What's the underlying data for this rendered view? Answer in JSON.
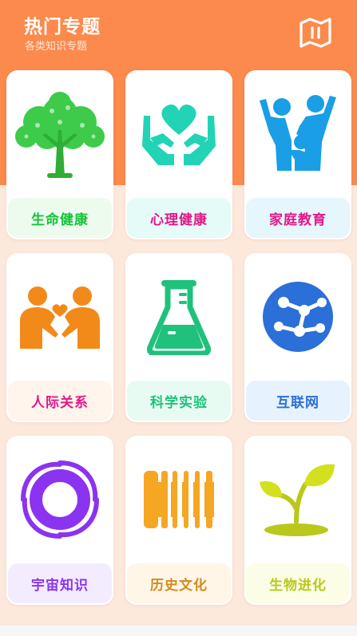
{
  "header": {
    "title": "热门专题",
    "subtitle": "各类知识专题",
    "map_icon": "map-icon"
  },
  "topics": [
    {
      "label": "生命健康",
      "icon": "tree-icon",
      "color": "#15c23a",
      "label_bg": "#edfbef"
    },
    {
      "label": "心理健康",
      "icon": "heart-hands-icon",
      "color": "#e0198a",
      "label_bg": "#e5fbf8"
    },
    {
      "label": "家庭教育",
      "icon": "family-icon",
      "color": "#e0198a",
      "label_bg": "#e6f6fd"
    },
    {
      "label": "人际关系",
      "icon": "people-heart-icon",
      "color": "#e0198a",
      "label_bg": "#fff5ec"
    },
    {
      "label": "科学实验",
      "icon": "flask-icon",
      "color": "#1ec27c",
      "label_bg": "#e8fbf2"
    },
    {
      "label": "互联网",
      "icon": "network-globe-icon",
      "color": "#2b6fd8",
      "label_bg": "#e6f2fd"
    },
    {
      "label": "宇宙知识",
      "icon": "galaxy-icon",
      "color": "#8a33f0",
      "label_bg": "#f3ecfe"
    },
    {
      "label": "历史文化",
      "icon": "scroll-icon",
      "color": "#d48a1c",
      "label_bg": "#fff6e8"
    },
    {
      "label": "生物进化",
      "icon": "sprout-icon",
      "color": "#b9c81a",
      "label_bg": "#fbfde6"
    }
  ]
}
